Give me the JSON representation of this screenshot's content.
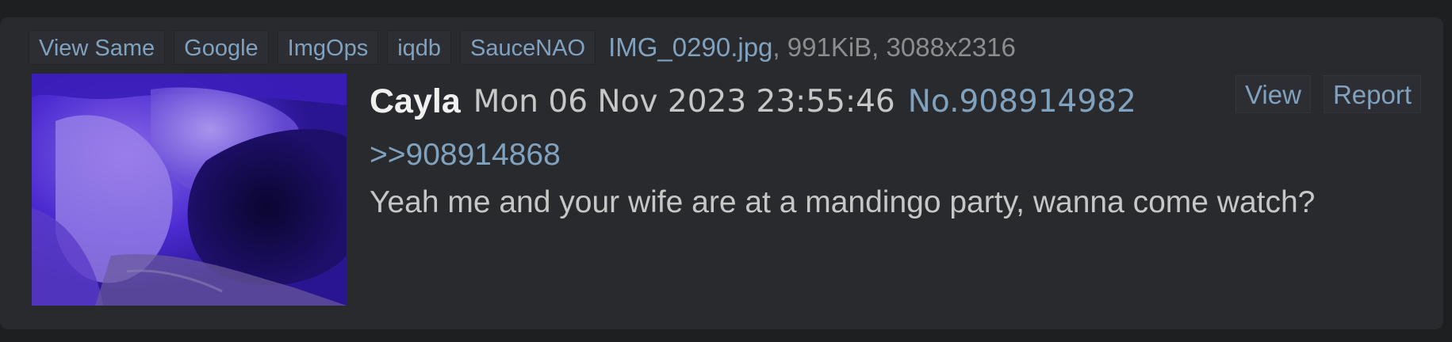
{
  "file_bar": {
    "buttons": [
      "View Same",
      "Google",
      "ImgOps",
      "iqdb",
      "SauceNAO"
    ],
    "file_name": "IMG_0290.jpg",
    "file_meta": ", 991KiB, 3088x2316"
  },
  "post": {
    "name": "Cayla",
    "date": "Mon 06 Nov 2023 23:55:46",
    "number": "No.908914982",
    "actions": [
      "View",
      "Report"
    ],
    "quote_link": ">>908914868",
    "body": "Yeah me and your wife are at a mandingo party, wanna come watch?"
  },
  "colors": {
    "page_bg": "#1d1f21",
    "post_bg": "#282a2e",
    "link": "#81a2be",
    "text": "#c5c8c6",
    "name": "#f0f0f0",
    "thumb_tint": "#3a1fb0"
  }
}
